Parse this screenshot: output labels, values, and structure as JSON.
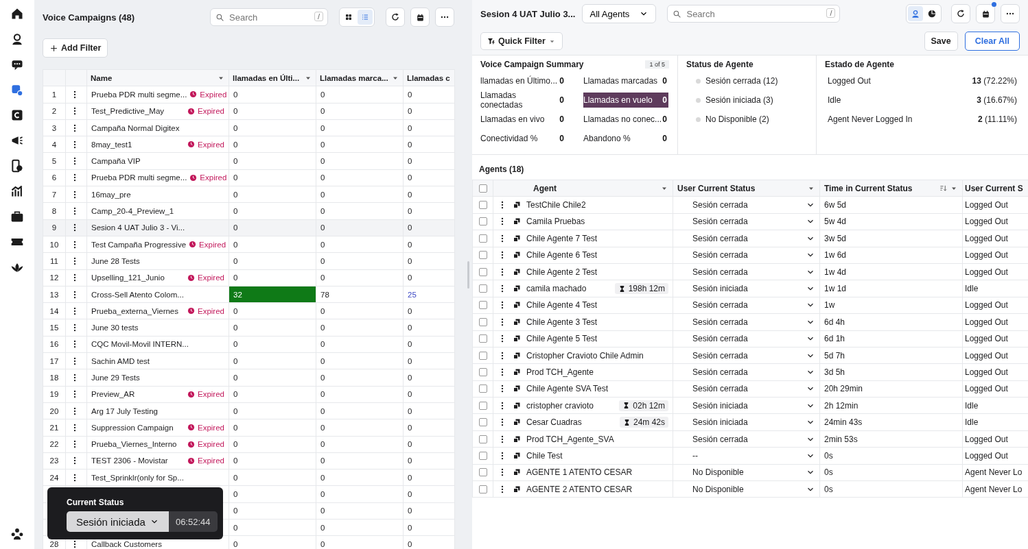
{
  "sidebar": {
    "items": [
      {
        "selected": false
      },
      {
        "selected": false
      },
      {
        "selected": false
      },
      {
        "selected": true
      },
      {
        "selected": false
      },
      {
        "selected": false
      },
      {
        "selected": false
      },
      {
        "selected": false
      },
      {
        "selected": false
      },
      {
        "selected": false
      },
      {
        "selected": false
      },
      {
        "selected": false
      }
    ]
  },
  "campaigns": {
    "title": "Voice Campaigns (48)",
    "search": {
      "placeholder": "Search",
      "shortcut": "/"
    },
    "view_toggle": [
      {
        "selected": false
      },
      {
        "selected": true
      }
    ],
    "add_filter": "Add Filter",
    "columns": [
      "Name",
      "llamadas en Últi...",
      "Llamadas marca...",
      "Llamadas c"
    ],
    "rows": [
      {
        "num": "1",
        "name": "Prueba PDR multi segme...",
        "badge": "Expired",
        "values": [
          "0",
          "0",
          "0"
        ]
      },
      {
        "num": "2",
        "name": "Test_Predictive_May",
        "badge": "Expired",
        "values": [
          "0",
          "0",
          "0"
        ]
      },
      {
        "num": "3",
        "name": "Campaña Normal Digitex",
        "values": [
          "0",
          "0",
          "0"
        ]
      },
      {
        "num": "4",
        "name": "8may_test1",
        "badge": "Expired",
        "values": [
          "0",
          "0",
          "0"
        ]
      },
      {
        "num": "5",
        "name": "Campaña VIP",
        "values": [
          "0",
          "0",
          "0"
        ]
      },
      {
        "num": "6",
        "name": "Prueba PDR multi segme...",
        "badge": "Expired",
        "values": [
          "0",
          "0",
          "0"
        ]
      },
      {
        "num": "7",
        "name": "16may_pre",
        "values": [
          "0",
          "0",
          "0"
        ]
      },
      {
        "num": "8",
        "name": "Camp_20-4_Preview_1",
        "values": [
          "0",
          "0",
          "0"
        ]
      },
      {
        "num": "9",
        "name": "Sesion 4 UAT Julio 3 - Vi...",
        "selected": true,
        "values": [
          "0",
          "0",
          "0"
        ]
      },
      {
        "num": "10",
        "name": "Test Campaña Progressive",
        "badge": "Expired",
        "values": [
          "0",
          "0",
          "0"
        ]
      },
      {
        "num": "11",
        "name": "June 28 Tests",
        "values": [
          "0",
          "0",
          "0"
        ]
      },
      {
        "num": "12",
        "name": "Upselling_121_Junio",
        "badge": "Expired",
        "values": [
          "0",
          "0",
          "0"
        ]
      },
      {
        "num": "13",
        "name": "Cross-Sell Atento Colom...",
        "values": [
          "32",
          "78",
          "25"
        ],
        "cells": [
          {
            "kind": "filled"
          },
          {
            "kind": "plain"
          },
          {
            "kind": "link"
          }
        ]
      },
      {
        "num": "14",
        "name": "Prueba_externa_Viernes",
        "badge": "Expired",
        "values": [
          "0",
          "0",
          "0"
        ]
      },
      {
        "num": "15",
        "name": "June 30 tests",
        "values": [
          "0",
          "0",
          "0"
        ]
      },
      {
        "num": "16",
        "name": "CQC Movil-Movil INTERN...",
        "values": [
          "0",
          "0",
          "0"
        ]
      },
      {
        "num": "17",
        "name": "Sachin AMD test",
        "values": [
          "0",
          "0",
          "0"
        ]
      },
      {
        "num": "18",
        "name": "June 29 Tests",
        "values": [
          "0",
          "0",
          "0"
        ]
      },
      {
        "num": "19",
        "name": "Preview_AR",
        "badge": "Expired",
        "values": [
          "0",
          "0",
          "0"
        ]
      },
      {
        "num": "20",
        "name": "Arg 17 July Testing",
        "values": [
          "0",
          "0",
          "0"
        ]
      },
      {
        "num": "21",
        "name": "Suppression Campaign",
        "badge": "Expired",
        "values": [
          "0",
          "0",
          "0"
        ]
      },
      {
        "num": "22",
        "name": "Prueba_Viernes_Interno",
        "badge": "Expired",
        "values": [
          "0",
          "0",
          "0"
        ]
      },
      {
        "num": "23",
        "name": "TEST 2306 - Movistar",
        "badge": "Expired",
        "values": [
          "0",
          "0",
          "0"
        ]
      },
      {
        "num": "24",
        "name": "Test_Sprinklr(only for Sp...",
        "values": [
          "0",
          "0",
          "0"
        ]
      },
      {
        "values": [
          "0",
          "0",
          "0"
        ]
      },
      {
        "values": [
          "0",
          "0",
          "0"
        ]
      },
      {
        "values": [
          "0",
          "0",
          "0"
        ]
      },
      {
        "num": "28",
        "name": "Callback Customers",
        "values": [
          "0",
          "0",
          "0"
        ]
      }
    ]
  },
  "status_popup": {
    "title": "Current Status",
    "status": "Sesión iniciada",
    "timer": "06:52:44"
  },
  "detail": {
    "title": "Sesion 4 UAT Julio 3...",
    "agent_filter": "All Agents",
    "search": {
      "placeholder": "Search",
      "shortcut": "/"
    },
    "view_toggle": [
      {
        "selected": true
      },
      {
        "selected": false
      }
    ],
    "calendar_notification": true,
    "quick_filter": "Quick Filter",
    "save": "Save",
    "clear_all": "Clear All",
    "summary": {
      "title": "Voice Campaign Summary",
      "pager": "1 of 5",
      "metrics": [
        {
          "label": "llamadas en Último...",
          "value": "0",
          "highlighted": false
        },
        {
          "label": "Llamadas marcadas",
          "value": "0",
          "highlighted": false
        },
        {
          "label": "Llamadas conectadas",
          "value": "0",
          "highlighted": false
        },
        {
          "label": "Llamadas en vuelo",
          "value": "0",
          "highlighted": true
        },
        {
          "label": "Llamadas en vivo",
          "value": "0",
          "highlighted": false
        },
        {
          "label": "Llamadas no conec...",
          "value": "0",
          "highlighted": false
        },
        {
          "label": "Conectividad %",
          "value": "0",
          "highlighted": false
        },
        {
          "label": "Abandono %",
          "value": "0",
          "highlighted": false
        }
      ]
    },
    "status_de_agente": {
      "title": "Status de Agente",
      "items": [
        {
          "label": "Sesión cerrada (12)",
          "color": "#d9d9d9"
        },
        {
          "label": "Sesión iniciada (3)",
          "color": "#d9d9d9"
        },
        {
          "label": "No Disponible (2)",
          "color": "#d9d9d9"
        }
      ]
    },
    "estado_de_agente": {
      "title": "Estado de Agente",
      "items": [
        {
          "label": "Logged Out",
          "count": "13",
          "percent": "(72.22%)"
        },
        {
          "label": "Idle",
          "count": "3",
          "percent": "(16.67%)"
        },
        {
          "label": "Agent Never Logged In",
          "count": "2",
          "percent": "(11.11%)"
        }
      ]
    },
    "agents": {
      "title": "Agents (18)",
      "select_all": {
        "checked": false
      },
      "columns": [
        "Agent",
        "User Current Status",
        "Time in Current Status",
        "User Current S"
      ],
      "rows": [
        {
          "checked": false,
          "name": "TestChile Chile2",
          "status": "Sesión cerrada",
          "time": "6w 5d",
          "state": "Logged Out"
        },
        {
          "checked": false,
          "name": "Camila Pruebas",
          "status": "Sesión cerrada",
          "time": "5w 4d",
          "state": "Logged Out"
        },
        {
          "checked": false,
          "name": "Chile Agente 7 Test",
          "status": "Sesión cerrada",
          "time": "3w 5d",
          "state": "Logged Out"
        },
        {
          "checked": false,
          "name": "Chile Agente 6 Test",
          "status": "Sesión cerrada",
          "time": "1w 6d",
          "state": "Logged Out"
        },
        {
          "checked": false,
          "name": "Chile Agente 2 Test",
          "status": "Sesión cerrada",
          "time": "1w 4d",
          "state": "Logged Out"
        },
        {
          "checked": false,
          "name": "camila machado",
          "timer": "198h 12m",
          "status": "Sesión iniciada",
          "time": "1w 1d",
          "state": "Idle"
        },
        {
          "checked": false,
          "name": "Chile Agente 4 Test",
          "status": "Sesión cerrada",
          "time": "1w",
          "state": "Logged Out"
        },
        {
          "checked": false,
          "name": "Chile Agente 3 Test",
          "status": "Sesión cerrada",
          "time": "6d 4h",
          "state": "Logged Out"
        },
        {
          "checked": false,
          "name": "Chile Agente 5 Test",
          "status": "Sesión cerrada",
          "time": "6d 1h",
          "state": "Logged Out"
        },
        {
          "checked": false,
          "name": "Cristopher Cravioto Chile Admin",
          "status": "Sesión cerrada",
          "time": "5d 7h",
          "state": "Logged Out"
        },
        {
          "checked": false,
          "name": "Prod TCH_Agente",
          "status": "Sesión cerrada",
          "time": "3d 5h",
          "state": "Logged Out"
        },
        {
          "checked": false,
          "name": "Chile Agente SVA Test",
          "status": "Sesión cerrada",
          "time": "20h 29min",
          "state": "Logged Out"
        },
        {
          "checked": false,
          "name": "cristopher cravioto",
          "timer": "02h 12m",
          "status": "Sesión iniciada",
          "time": "2h 12min",
          "state": "Idle"
        },
        {
          "checked": false,
          "name": "Cesar Cuadras",
          "timer": "24m 42s",
          "status": "Sesión iniciada",
          "time": "24min 43s",
          "state": "Idle"
        },
        {
          "checked": false,
          "name": "Prod TCH_Agente_SVA",
          "status": "Sesión cerrada",
          "time": "2min 53s",
          "state": "Logged Out"
        },
        {
          "checked": false,
          "name": "Chile Test",
          "status": "--",
          "time": "0s",
          "state": "Logged Out"
        },
        {
          "checked": false,
          "name": "AGENTE 1 ATENTO CESAR",
          "status": "No Disponible",
          "time": "0s",
          "state": "Agent Never Lo"
        },
        {
          "checked": false,
          "name": "AGENTE 2 ATENTO CESAR",
          "status": "No Disponible",
          "time": "0s",
          "state": "Agent Never Lo"
        }
      ]
    }
  }
}
